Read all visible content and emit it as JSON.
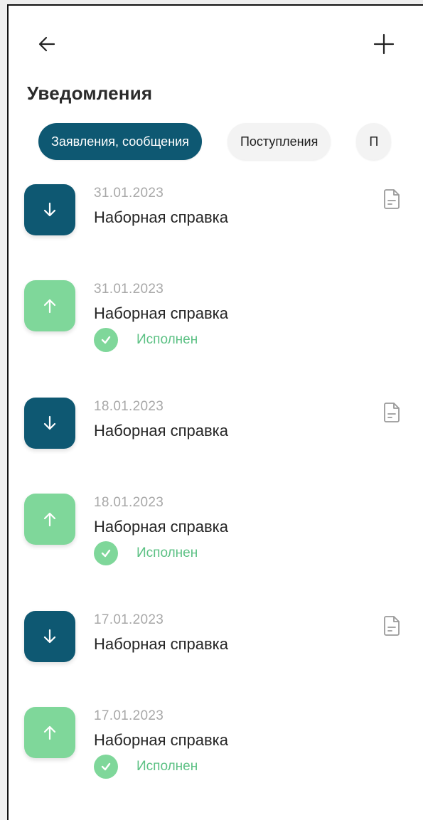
{
  "header": {
    "back_icon": "arrow-left-icon",
    "add_icon": "plus-icon",
    "title": "Уведомления"
  },
  "tabs": [
    {
      "label": "Заявления, сообщения",
      "active": true
    },
    {
      "label": "Поступления",
      "active": false
    },
    {
      "label": "П",
      "active": false
    }
  ],
  "notifications": [
    {
      "direction": "incoming",
      "icon": "arrow-down-icon",
      "date": "31.01.2023",
      "title": "Наборная справка",
      "status": null,
      "has_document": true
    },
    {
      "direction": "outgoing",
      "icon": "arrow-up-icon",
      "date": "31.01.2023",
      "title": "Наборная справка",
      "status": "Исполнен",
      "has_document": false
    },
    {
      "direction": "incoming",
      "icon": "arrow-down-icon",
      "date": "18.01.2023",
      "title": "Наборная справка",
      "status": null,
      "has_document": true
    },
    {
      "direction": "outgoing",
      "icon": "arrow-up-icon",
      "date": "18.01.2023",
      "title": "Наборная справка",
      "status": "Исполнен",
      "has_document": false
    },
    {
      "direction": "incoming",
      "icon": "arrow-down-icon",
      "date": "17.01.2023",
      "title": "Наборная справка",
      "status": null,
      "has_document": true
    },
    {
      "direction": "outgoing",
      "icon": "arrow-up-icon",
      "date": "17.01.2023",
      "title": "Наборная справка",
      "status": "Исполнен",
      "has_document": false
    }
  ],
  "colors": {
    "incoming": "#0e5872",
    "outgoing": "#7fd79a",
    "status_text": "#5cc184",
    "active_tab": "#0e5872"
  }
}
